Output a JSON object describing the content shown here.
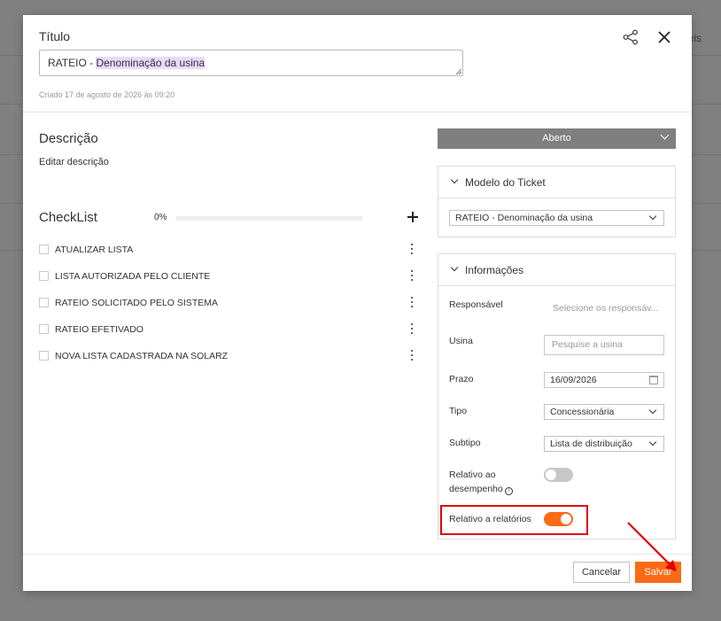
{
  "background": {
    "partial_text": "eis"
  },
  "header": {
    "title_label": "Título",
    "title_prefix": "RATEIO - ",
    "title_highlight": "Denominação da usina",
    "created": "Criado 17 de agosto de 2026 às 09:20"
  },
  "description": {
    "title": "Descrição",
    "edit_label": "Editar descrição"
  },
  "checklist": {
    "title": "CheckList",
    "progress_text": "0%",
    "progress_value": 0,
    "items": [
      {
        "label": "ATUALIZAR LISTA"
      },
      {
        "label": "LISTA AUTORIZADA PELO CLIENTE"
      },
      {
        "label": "RATEIO SOLICITADO PELO SISTEMA"
      },
      {
        "label": "RATEIO EFETIVADO"
      },
      {
        "label": "NOVA LISTA CADASTRADA NA SOLARZ"
      }
    ]
  },
  "status": {
    "value": "Aberto"
  },
  "ticket_model": {
    "title": "Modelo do Ticket",
    "value": "RATEIO - Denominação da usina"
  },
  "info": {
    "title": "Informações",
    "responsavel_label": "Responsável",
    "responsavel_placeholder": "Selecione os responsáv...",
    "usina_label": "Usina",
    "usina_placeholder": "Pesquise a usina",
    "prazo_label": "Prazo",
    "prazo_value": "16/09/2026",
    "tipo_label": "Tipo",
    "tipo_value": "Concessionária",
    "subtipo_label": "Subtipo",
    "subtipo_value": "Lista de distribuição",
    "relativo_desempenho_line1": "Relativo ao",
    "relativo_desempenho_line2": "desempenho",
    "relativo_desempenho_on": false,
    "relativo_relatorios_label": "Relativo a relatórios",
    "relativo_relatorios_on": true
  },
  "footer": {
    "cancel_label": "Cancelar",
    "save_label": "Salvar"
  },
  "colors": {
    "accent": "#fd6a16",
    "annotation": "#e10000",
    "status_bg": "#7f7f7f"
  }
}
